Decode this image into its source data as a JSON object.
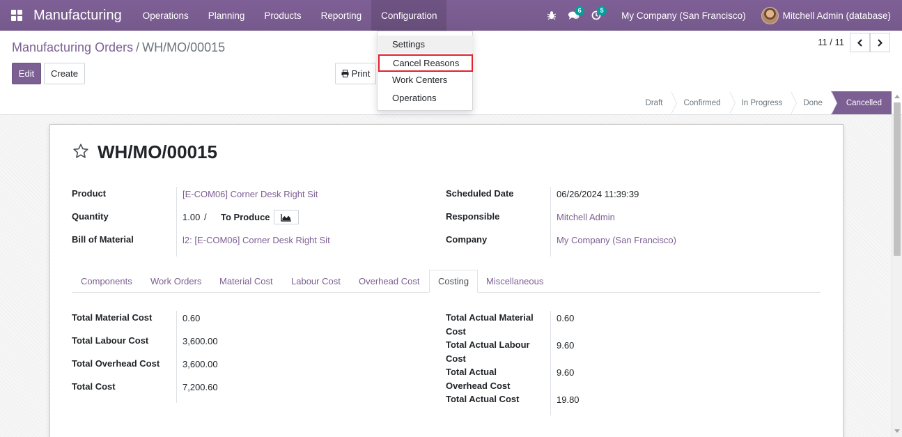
{
  "navbar": {
    "app_name": "Manufacturing",
    "menus": [
      "Operations",
      "Planning",
      "Products",
      "Reporting",
      "Configuration"
    ],
    "messages_count": "6",
    "activities_count": "5",
    "company": "My Company (San Francisco)",
    "user": "Mitchell Admin (database)"
  },
  "config_menu": {
    "items": [
      "Settings",
      "Cancel Reasons",
      "Work Centers",
      "Operations"
    ]
  },
  "breadcrumb": {
    "parent": "Manufacturing Orders",
    "separator": "/",
    "current": "WH/MO/00015"
  },
  "actions": {
    "edit": "Edit",
    "create": "Create",
    "print": "Print"
  },
  "pager": {
    "value": "11 / 11"
  },
  "stages": [
    "Draft",
    "Confirmed",
    "In Progress",
    "Done",
    "Cancelled"
  ],
  "current_stage": "Cancelled",
  "record": {
    "title": "WH/MO/00015",
    "product_label": "Product",
    "product": "[E-COM06] Corner Desk Right Sit",
    "quantity_label": "Quantity",
    "quantity": "1.00",
    "quantity_sep": "/",
    "to_produce_label": "To Produce",
    "bom_label": "Bill of Material",
    "bom": "l2: [E-COM06] Corner Desk Right Sit",
    "scheduled_label": "Scheduled Date",
    "scheduled": "06/26/2024 11:39:39",
    "responsible_label": "Responsible",
    "responsible": "Mitchell Admin",
    "company_label": "Company",
    "company": "My Company (San Francisco)"
  },
  "tabs": [
    "Components",
    "Work Orders",
    "Material Cost",
    "Labour Cost",
    "Overhead Cost",
    "Costing",
    "Miscellaneous"
  ],
  "active_tab": "Costing",
  "costing": {
    "left": [
      {
        "label": "Total Material Cost",
        "value": "0.60"
      },
      {
        "label": "Total Labour Cost",
        "value": "3,600.00"
      },
      {
        "label": "Total Overhead Cost",
        "value": "3,600.00"
      },
      {
        "label": "Total Cost",
        "value": "7,200.60"
      }
    ],
    "right": [
      {
        "label": "Total Actual Material Cost",
        "value": "0.60"
      },
      {
        "label": "Total Actual Labour Cost",
        "value": "9.60"
      },
      {
        "label": "Total Actual Overhead Cost",
        "value": "9.60"
      },
      {
        "label": "Total Actual Cost",
        "value": "19.80"
      }
    ]
  },
  "colors": {
    "brand": "#7c5f93",
    "teal_badge": "#00a09d",
    "highlight_box": "#e0212f"
  }
}
